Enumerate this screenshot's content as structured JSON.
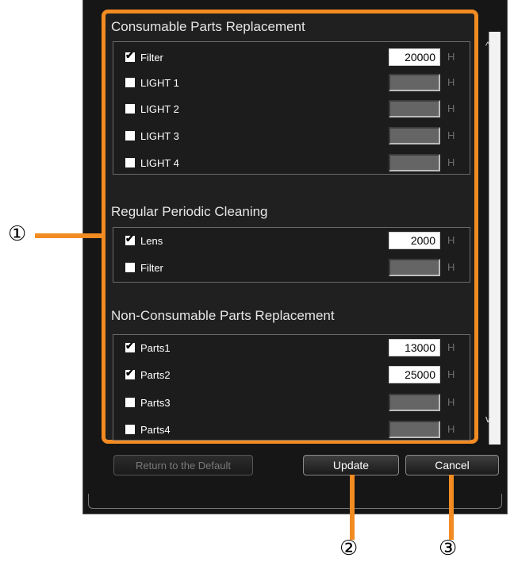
{
  "sections": {
    "consumable": {
      "title": "Consumable Parts Replacement"
    },
    "cleaning": {
      "title": "Regular Periodic Cleaning"
    },
    "non_consumable": {
      "title": "Non-Consumable Parts Replacement"
    }
  },
  "rows": [
    {
      "label": "Filter",
      "checked": true,
      "hours": "20000",
      "unit": "H"
    },
    {
      "label": "LIGHT 1",
      "checked": false,
      "hours": "",
      "unit": "H"
    },
    {
      "label": "LIGHT 2",
      "checked": false,
      "hours": "",
      "unit": "H"
    },
    {
      "label": "LIGHT 3",
      "checked": false,
      "hours": "",
      "unit": "H"
    },
    {
      "label": "LIGHT 4",
      "checked": false,
      "hours": "",
      "unit": "H"
    },
    {
      "label": "Lens",
      "checked": true,
      "hours": "2000",
      "unit": "H"
    },
    {
      "label": "Filter",
      "checked": false,
      "hours": "",
      "unit": "H"
    },
    {
      "label": "Parts1",
      "checked": true,
      "hours": "13000",
      "unit": "H"
    },
    {
      "label": "Parts2",
      "checked": true,
      "hours": "25000",
      "unit": "H"
    },
    {
      "label": "Parts3",
      "checked": false,
      "hours": "",
      "unit": "H"
    },
    {
      "label": "Parts4",
      "checked": false,
      "hours": "",
      "unit": "H"
    }
  ],
  "check_glyph": "✔",
  "buttons": {
    "default": "Return to the Default",
    "update": "Update",
    "cancel": "Cancel"
  },
  "callouts": {
    "one": "①",
    "two": "②",
    "three": "③"
  },
  "scroll": {
    "up": "^",
    "down": "v"
  },
  "colors": {
    "accent": "#f28b21",
    "dialog_bg": "#161616",
    "panel_bg": "#202020"
  }
}
